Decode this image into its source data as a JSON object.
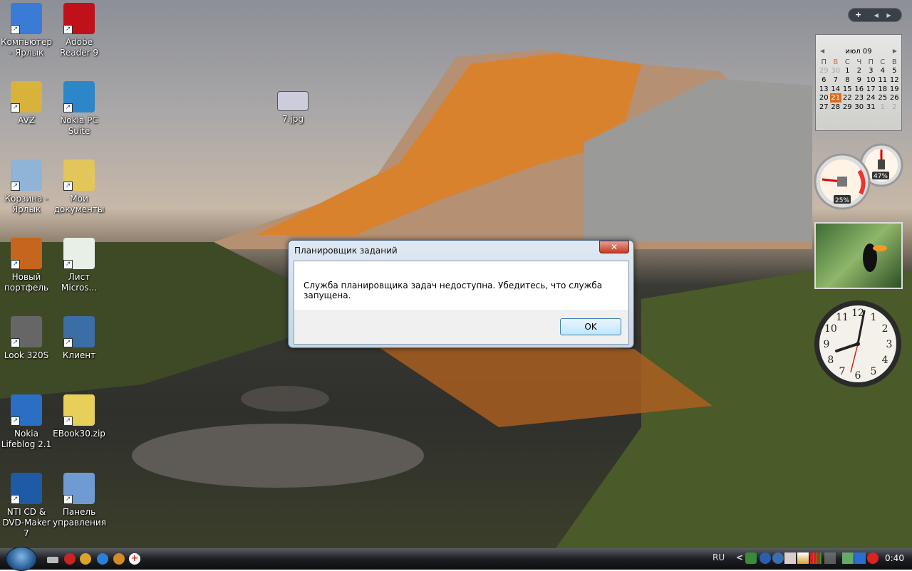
{
  "desktop_icons": [
    {
      "label": "Компьютер - Ярлык",
      "color": "#3a7bd5"
    },
    {
      "label": "Adobe Reader 9",
      "color": "#c0111a"
    },
    {
      "label": "AVZ",
      "color": "#d8b23a"
    },
    {
      "label": "Nokia PC Suite",
      "color": "#2c86c7"
    },
    {
      "label": "Корзина - Ярлык",
      "color": "#8fb4d6"
    },
    {
      "label": "Мои документы",
      "color": "#e2c65a"
    },
    {
      "label": "Новый портфель",
      "color": "#c6651e"
    },
    {
      "label": "Лист Micros...",
      "color": "#e8efe6"
    },
    {
      "label": "Look 320S",
      "color": "#666666"
    },
    {
      "label": "Клиент",
      "color": "#3a6ea5"
    },
    {
      "label": "Nokia Lifeblog 2.1",
      "color": "#2a6fc4"
    },
    {
      "label": "EBook30.zip",
      "color": "#e8cf5a"
    },
    {
      "label": "NTI CD & DVD-Maker 7",
      "color": "#1f5aa6"
    },
    {
      "label": "Панель управления",
      "color": "#6f9bd2"
    }
  ],
  "file_icon": {
    "label": "7.jpg"
  },
  "dialog": {
    "title": "Планировщик заданий",
    "message": "Служба планировщика задач недоступна. Убедитесь, что служба запущена.",
    "ok_label": "OK",
    "close_label": "✕"
  },
  "sidebar": {
    "add": "+",
    "prev": "◀",
    "next": "▶"
  },
  "calendar": {
    "month": "июл 09",
    "weekdays": [
      "П",
      "В",
      "С",
      "Ч",
      "П",
      "С",
      "В"
    ],
    "weeks": [
      [
        "29",
        "30",
        "1",
        "2",
        "3",
        "4",
        "5"
      ],
      [
        "6",
        "7",
        "8",
        "9",
        "10",
        "11",
        "12"
      ],
      [
        "13",
        "14",
        "15",
        "16",
        "17",
        "18",
        "19"
      ],
      [
        "20",
        "21",
        "22",
        "23",
        "24",
        "25",
        "26"
      ],
      [
        "27",
        "28",
        "29",
        "30",
        "31",
        "1",
        "2"
      ]
    ],
    "today": "21",
    "prev": "◀",
    "next": "▶"
  },
  "cpu_meter": {
    "cpu": "25%",
    "ram": "47%"
  },
  "clock": {
    "numbers": [
      "12",
      "1",
      "2",
      "3",
      "4",
      "5",
      "6",
      "7",
      "8",
      "9",
      "10",
      "11"
    ]
  },
  "taskbar": {
    "language": "RU",
    "time": "0:40",
    "tray_expand": "<"
  },
  "colors": {
    "accent": "#e06a1a",
    "taskbar": "#1d1f22"
  }
}
